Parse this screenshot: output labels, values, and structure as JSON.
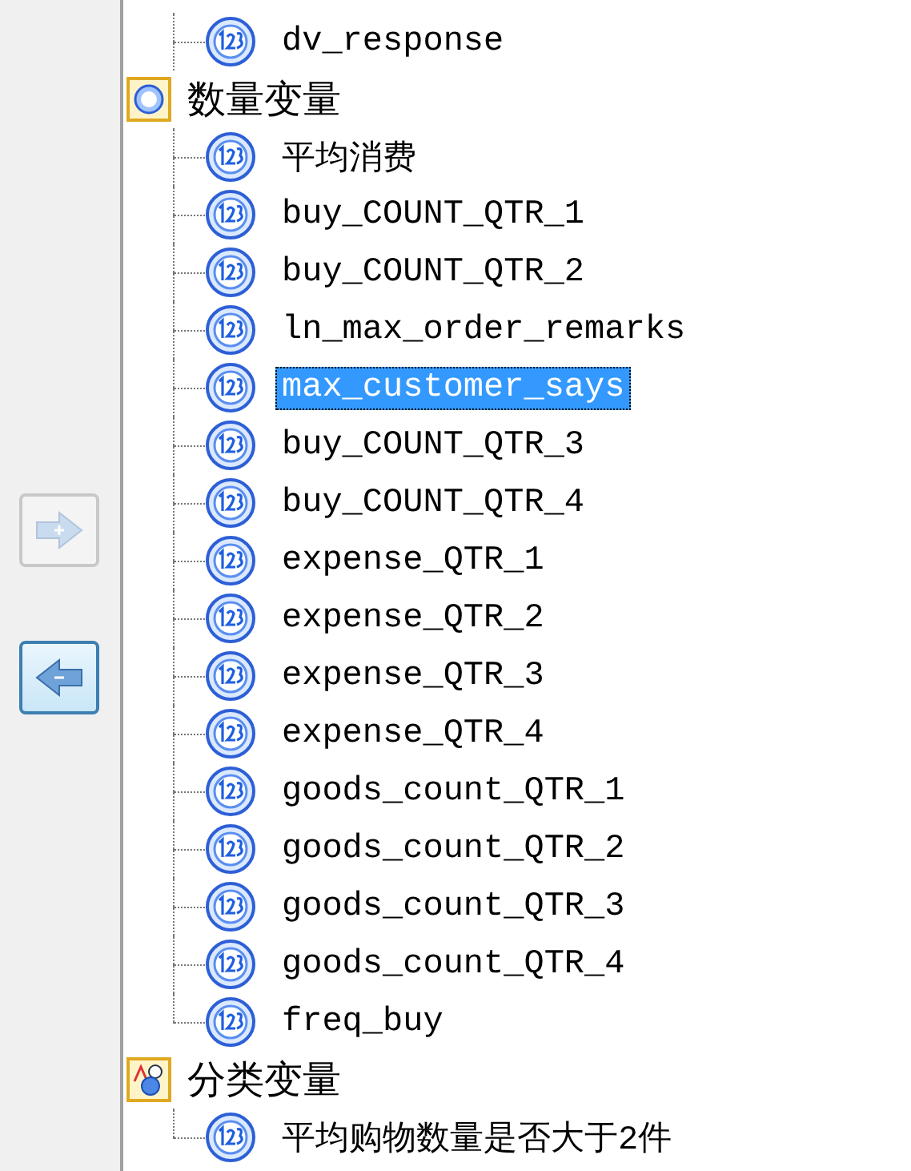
{
  "buttons": [
    {
      "kind": "add",
      "disabled": true
    },
    {
      "kind": "remove",
      "disabled": false
    }
  ],
  "tree": [
    {
      "kind": "leaf",
      "label": "dv_response",
      "selected": false
    },
    {
      "kind": "scale",
      "label": "数量变量",
      "selected": false,
      "children": [
        {
          "label": "平均消费",
          "selected": false
        },
        {
          "label": "buy_COUNT_QTR_1",
          "selected": false
        },
        {
          "label": "buy_COUNT_QTR_2",
          "selected": false
        },
        {
          "label": "ln_max_order_remarks",
          "selected": false
        },
        {
          "label": "max_customer_says",
          "selected": true
        },
        {
          "label": "buy_COUNT_QTR_3",
          "selected": false
        },
        {
          "label": "buy_COUNT_QTR_4",
          "selected": false
        },
        {
          "label": "expense_QTR_1",
          "selected": false
        },
        {
          "label": "expense_QTR_2",
          "selected": false
        },
        {
          "label": "expense_QTR_3",
          "selected": false
        },
        {
          "label": "expense_QTR_4",
          "selected": false
        },
        {
          "label": "goods_count_QTR_1",
          "selected": false
        },
        {
          "label": "goods_count_QTR_2",
          "selected": false
        },
        {
          "label": "goods_count_QTR_3",
          "selected": false
        },
        {
          "label": "goods_count_QTR_4",
          "selected": false
        },
        {
          "label": "freq_buy",
          "selected": false
        }
      ]
    },
    {
      "kind": "nominal",
      "label": "分类变量",
      "selected": false,
      "children": [
        {
          "label": "平均购物数量是否大于2件",
          "selected": false
        }
      ]
    }
  ]
}
